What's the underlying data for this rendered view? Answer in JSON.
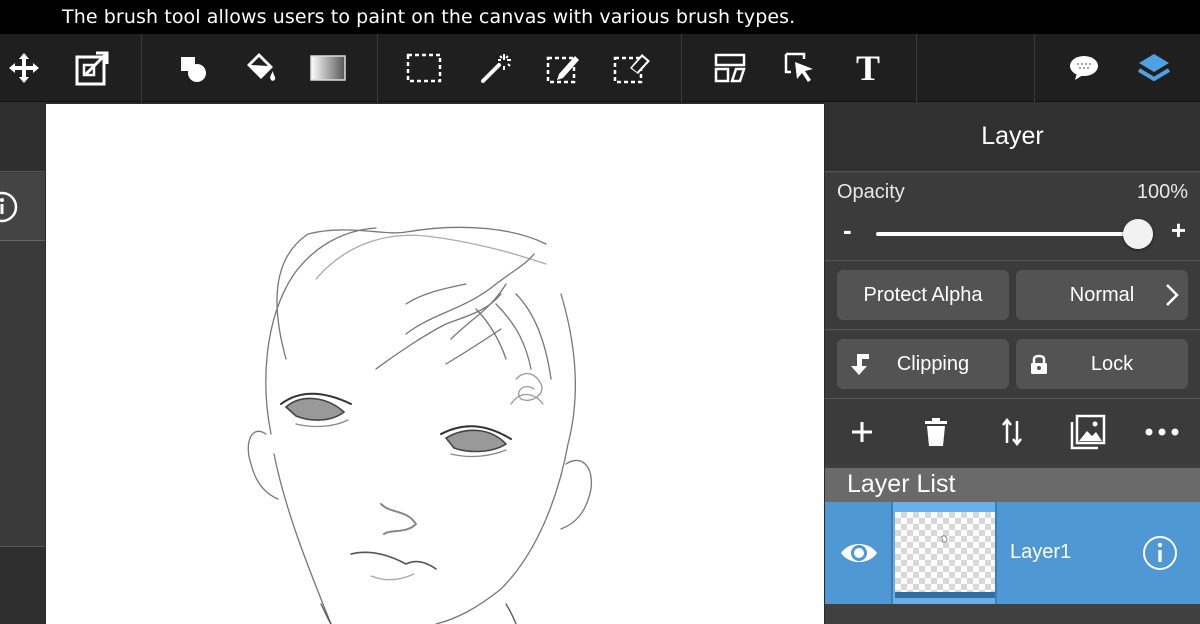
{
  "caption": "The brush tool allows users to paint on the canvas with various brush types.",
  "toolbar": {
    "tools": [
      {
        "name": "move-tool",
        "icon": "move-arrows-icon"
      },
      {
        "name": "transform-tool",
        "icon": "transform-icon"
      },
      {
        "name": "shape-tool",
        "icon": "shapes-icon"
      },
      {
        "name": "fill-tool",
        "icon": "paint-bucket-icon"
      },
      {
        "name": "gradient-tool",
        "icon": "gradient-icon"
      },
      {
        "name": "select-tool",
        "icon": "rect-select-icon"
      },
      {
        "name": "magic-wand-tool",
        "icon": "magic-wand-icon"
      },
      {
        "name": "select-pen-tool",
        "icon": "select-pen-icon"
      },
      {
        "name": "select-eraser-tool",
        "icon": "select-eraser-icon"
      },
      {
        "name": "frame-divider-tool",
        "icon": "frame-divider-icon"
      },
      {
        "name": "operation-tool",
        "icon": "cursor-icon"
      },
      {
        "name": "text-tool",
        "icon": "text-icon"
      },
      {
        "name": "bubble-tool",
        "icon": "speech-bubble-icon"
      },
      {
        "name": "layers-toggle",
        "icon": "layers-icon"
      }
    ],
    "text_tool_glyph": "T"
  },
  "layer_panel": {
    "title": "Layer",
    "opacity_label": "Opacity",
    "opacity_value": "100%",
    "opacity_fraction": 1.0,
    "minus": "-",
    "plus": "+",
    "protect_alpha": "Protect Alpha",
    "blend_mode": "Normal",
    "clipping": "Clipping",
    "lock": "Lock",
    "actions": [
      "add-layer",
      "delete-layer",
      "move-layer",
      "import-image",
      "more-options"
    ],
    "list_title": "Layer List",
    "layers": [
      {
        "name": "Layer1",
        "visible": true,
        "selected": true
      }
    ]
  },
  "colors": {
    "accent": "#4f98d3",
    "selected_icon": "#4ea2e3",
    "toolbar_bg": "#1f1f1f",
    "panel_bg": "#404040"
  }
}
